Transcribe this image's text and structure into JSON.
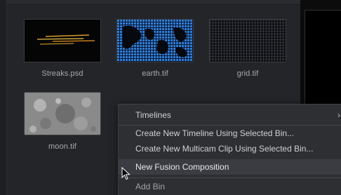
{
  "media_pool": {
    "clips": [
      {
        "name": "Streaks.psd",
        "thumb": "streaks"
      },
      {
        "name": "earth.tif",
        "thumb": "earth"
      },
      {
        "name": "grid.tif",
        "thumb": "grid"
      },
      {
        "name": "moon.tif",
        "thumb": "moon"
      }
    ]
  },
  "context_menu": {
    "items": [
      {
        "label": "Timelines",
        "has_submenu": true,
        "submenu_icon": "chevron-right-icon"
      },
      {
        "label": "Create New Timeline Using Selected Bin..."
      },
      {
        "label": "Create New Multicam Clip Using Selected Bin..."
      },
      {
        "label": "New Fusion Composition",
        "highlighted": true
      },
      {
        "label": "Add Bin"
      }
    ],
    "submenu_arrow": "›"
  },
  "colors": {
    "panel_bg": "#242528",
    "menu_bg": "#2e2f33",
    "menu_highlight": "#3b3c41",
    "earth_accent": "#2f7fd6"
  }
}
